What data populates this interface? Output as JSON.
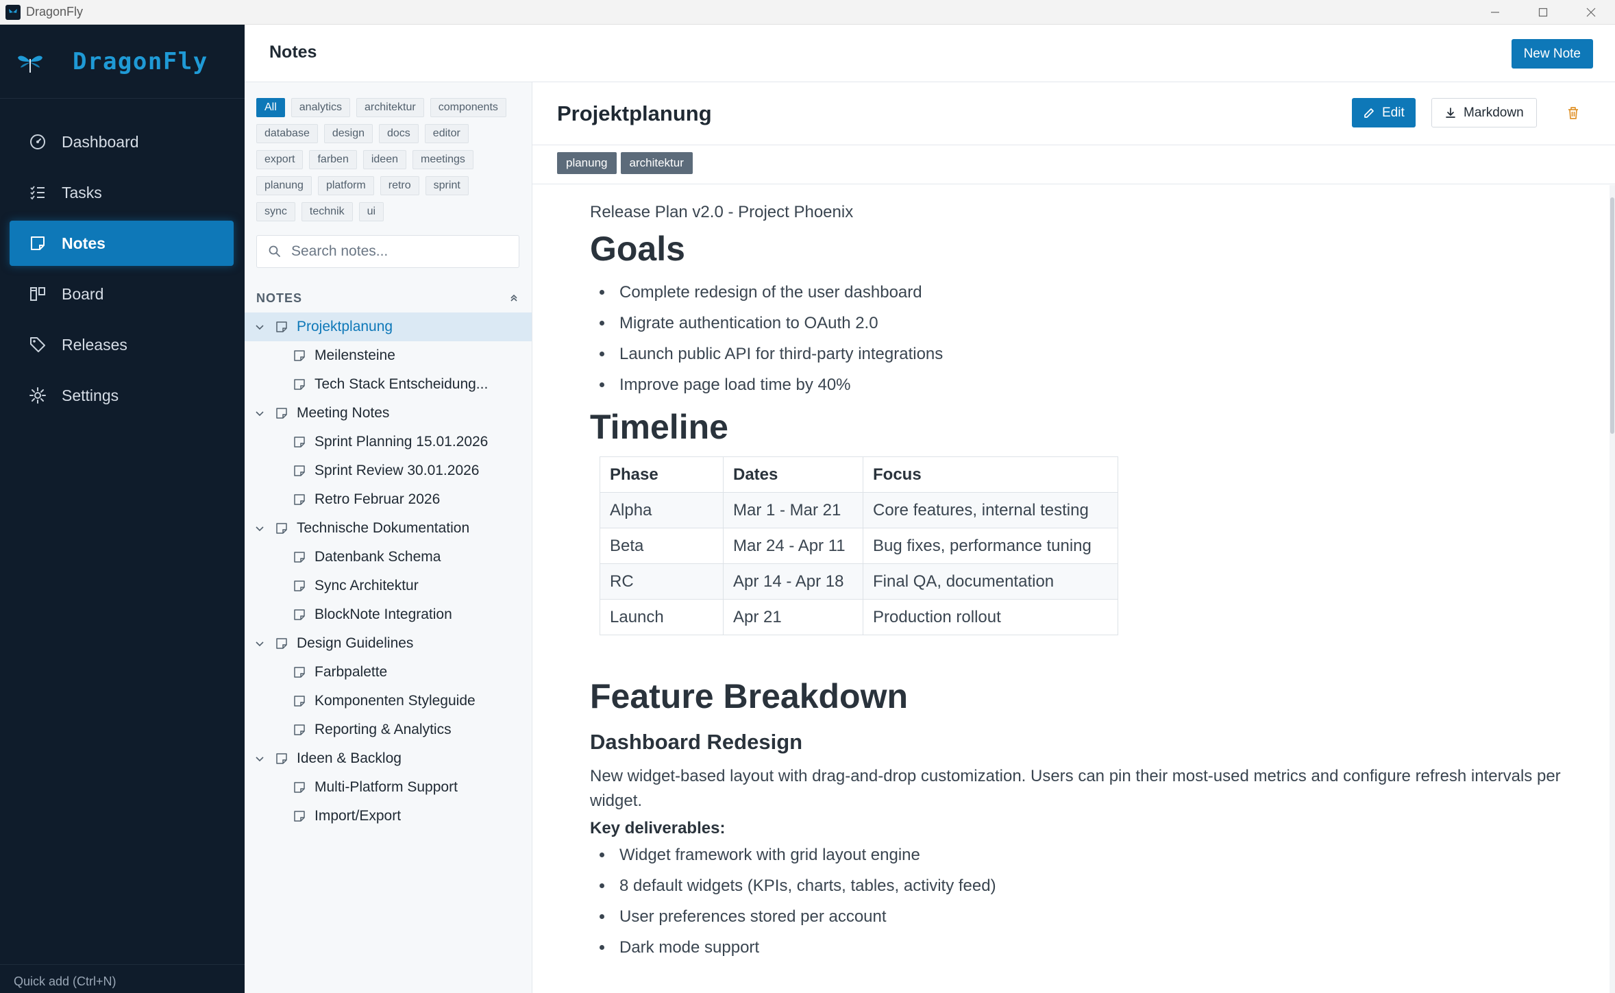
{
  "window": {
    "title": "DragonFly"
  },
  "brand": {
    "name": "DragonFly",
    "accent": "#1f9ad6",
    "logo_icon": "dragonfly-icon"
  },
  "sidebar": {
    "items": [
      {
        "label": "Dashboard",
        "icon": "gauge-icon",
        "active": false
      },
      {
        "label": "Tasks",
        "icon": "checklist-icon",
        "active": false
      },
      {
        "label": "Notes",
        "icon": "note-icon",
        "active": true
      },
      {
        "label": "Board",
        "icon": "kanban-icon",
        "active": false
      },
      {
        "label": "Releases",
        "icon": "tag-icon",
        "active": false
      },
      {
        "label": "Settings",
        "icon": "gear-icon",
        "active": false
      }
    ],
    "quick_add": "Quick add (Ctrl+N)"
  },
  "header": {
    "title": "Notes",
    "new_note_label": "New Note"
  },
  "tags": {
    "rows": [
      [
        "All",
        "analytics",
        "architektur",
        "components"
      ],
      [
        "database",
        "design",
        "docs",
        "editor"
      ],
      [
        "export",
        "farben",
        "ideen",
        "meetings"
      ],
      [
        "planung",
        "platform",
        "retro",
        "sprint"
      ],
      [
        "sync",
        "technik",
        "ui"
      ]
    ],
    "active": "All"
  },
  "search": {
    "placeholder": "Search notes...",
    "value": ""
  },
  "notes_section": {
    "label": "NOTES"
  },
  "tree": [
    {
      "label": "Projektplanung",
      "level": 0,
      "selected": true
    },
    {
      "label": "Meilensteine",
      "level": 1
    },
    {
      "label": "Tech Stack Entscheidung...",
      "level": 1
    },
    {
      "label": "Meeting Notes",
      "level": 0
    },
    {
      "label": "Sprint Planning 15.01.2026",
      "level": 1
    },
    {
      "label": "Sprint Review 30.01.2026",
      "level": 1
    },
    {
      "label": "Retro Februar 2026",
      "level": 1
    },
    {
      "label": "Technische Dokumentation",
      "level": 0
    },
    {
      "label": "Datenbank Schema",
      "level": 1
    },
    {
      "label": "Sync Architektur",
      "level": 1
    },
    {
      "label": "BlockNote Integration",
      "level": 1
    },
    {
      "label": "Design Guidelines",
      "level": 0
    },
    {
      "label": "Farbpalette",
      "level": 1
    },
    {
      "label": "Komponenten Styleguide",
      "level": 1
    },
    {
      "label": "Reporting & Analytics",
      "level": 1
    },
    {
      "label": "Ideen & Backlog",
      "level": 0
    },
    {
      "label": "Multi-Platform Support",
      "level": 1
    },
    {
      "label": "Import/Export",
      "level": 1
    }
  ],
  "note": {
    "title": "Projektplanung",
    "edit_label": "Edit",
    "markdown_label": "Markdown",
    "tags": [
      "planung",
      "architektur"
    ],
    "intro": "Release Plan v2.0 - Project Phoenix",
    "goals_heading": "Goals",
    "goals": [
      "Complete redesign of the user dashboard",
      "Migrate authentication to OAuth 2.0",
      "Launch public API for third-party integrations",
      "Improve page load time by 40%"
    ],
    "timeline_heading": "Timeline",
    "timeline": {
      "headers": [
        "Phase",
        "Dates",
        "Focus"
      ],
      "rows": [
        [
          "Alpha",
          "Mar 1 - Mar 21",
          "Core features, internal testing"
        ],
        [
          "Beta",
          "Mar 24 - Apr 11",
          "Bug fixes, performance tuning"
        ],
        [
          "RC",
          "Apr 14 - Apr 18",
          "Final QA, documentation"
        ],
        [
          "Launch",
          "Apr 21",
          "Production rollout"
        ]
      ]
    },
    "feature_heading": "Feature Breakdown",
    "dashboard_heading": "Dashboard Redesign",
    "dashboard_text": "New widget-based layout with drag-and-drop customization. Users can pin their most-used metrics and configure refresh intervals per widget.",
    "deliverables_label": "Key deliverables:",
    "deliverables": [
      "Widget framework with grid layout engine",
      "8 default widgets (KPIs, charts, tables, activity feed)",
      "User preferences stored per account",
      "Dark mode support"
    ]
  },
  "colors": {
    "sidebar_bg": "#0f1c2b",
    "primary": "#0e78b8",
    "danger_icon": "#e0922a",
    "tag_bg": "#5c6b7a"
  }
}
